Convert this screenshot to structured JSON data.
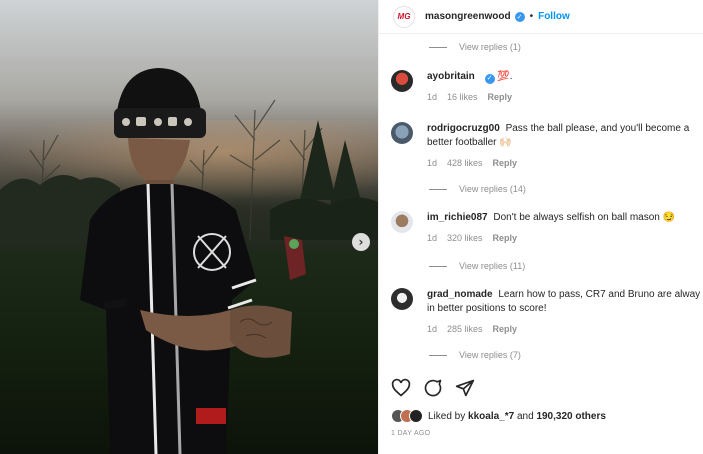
{
  "post": {
    "username": "masongreenwood",
    "logo_text": "MG",
    "follow_label": "Follow",
    "separator": "•",
    "verified_glyph": "✓",
    "next_glyph": "›"
  },
  "top_view_replies": "View replies (1)",
  "comments": [
    {
      "username": "ayobritain",
      "verified": true,
      "text": "💯.",
      "time": "1d",
      "likes": "16 likes",
      "reply": "Reply",
      "view_replies": ""
    },
    {
      "username": "rodrigocruzg00",
      "text": "Pass the ball please, and you'll become a better footballer 🙌🏻",
      "time": "1d",
      "likes": "428 likes",
      "reply": "Reply",
      "view_replies": "View replies (14)"
    },
    {
      "username": "im_richie087",
      "text": "Don't be always selfish on ball mason 😏",
      "time": "1d",
      "likes": "320 likes",
      "reply": "Reply",
      "view_replies": "View replies (11)"
    },
    {
      "username": "grad_nomade",
      "text": "Learn how to pass, CR7 and Bruno are alway in better positions to score!",
      "time": "1d",
      "likes": "285 likes",
      "reply": "Reply",
      "view_replies": "View replies (7)"
    }
  ],
  "actions": {
    "like_icon": "heart-icon",
    "comment_icon": "comment-icon",
    "share_icon": "share-icon"
  },
  "likes_summary": {
    "prefix": "Liked by",
    "user": "kkoala_*7",
    "middle": "and",
    "count": "190,320 others"
  },
  "timestamp": "1 DAY AGO"
}
